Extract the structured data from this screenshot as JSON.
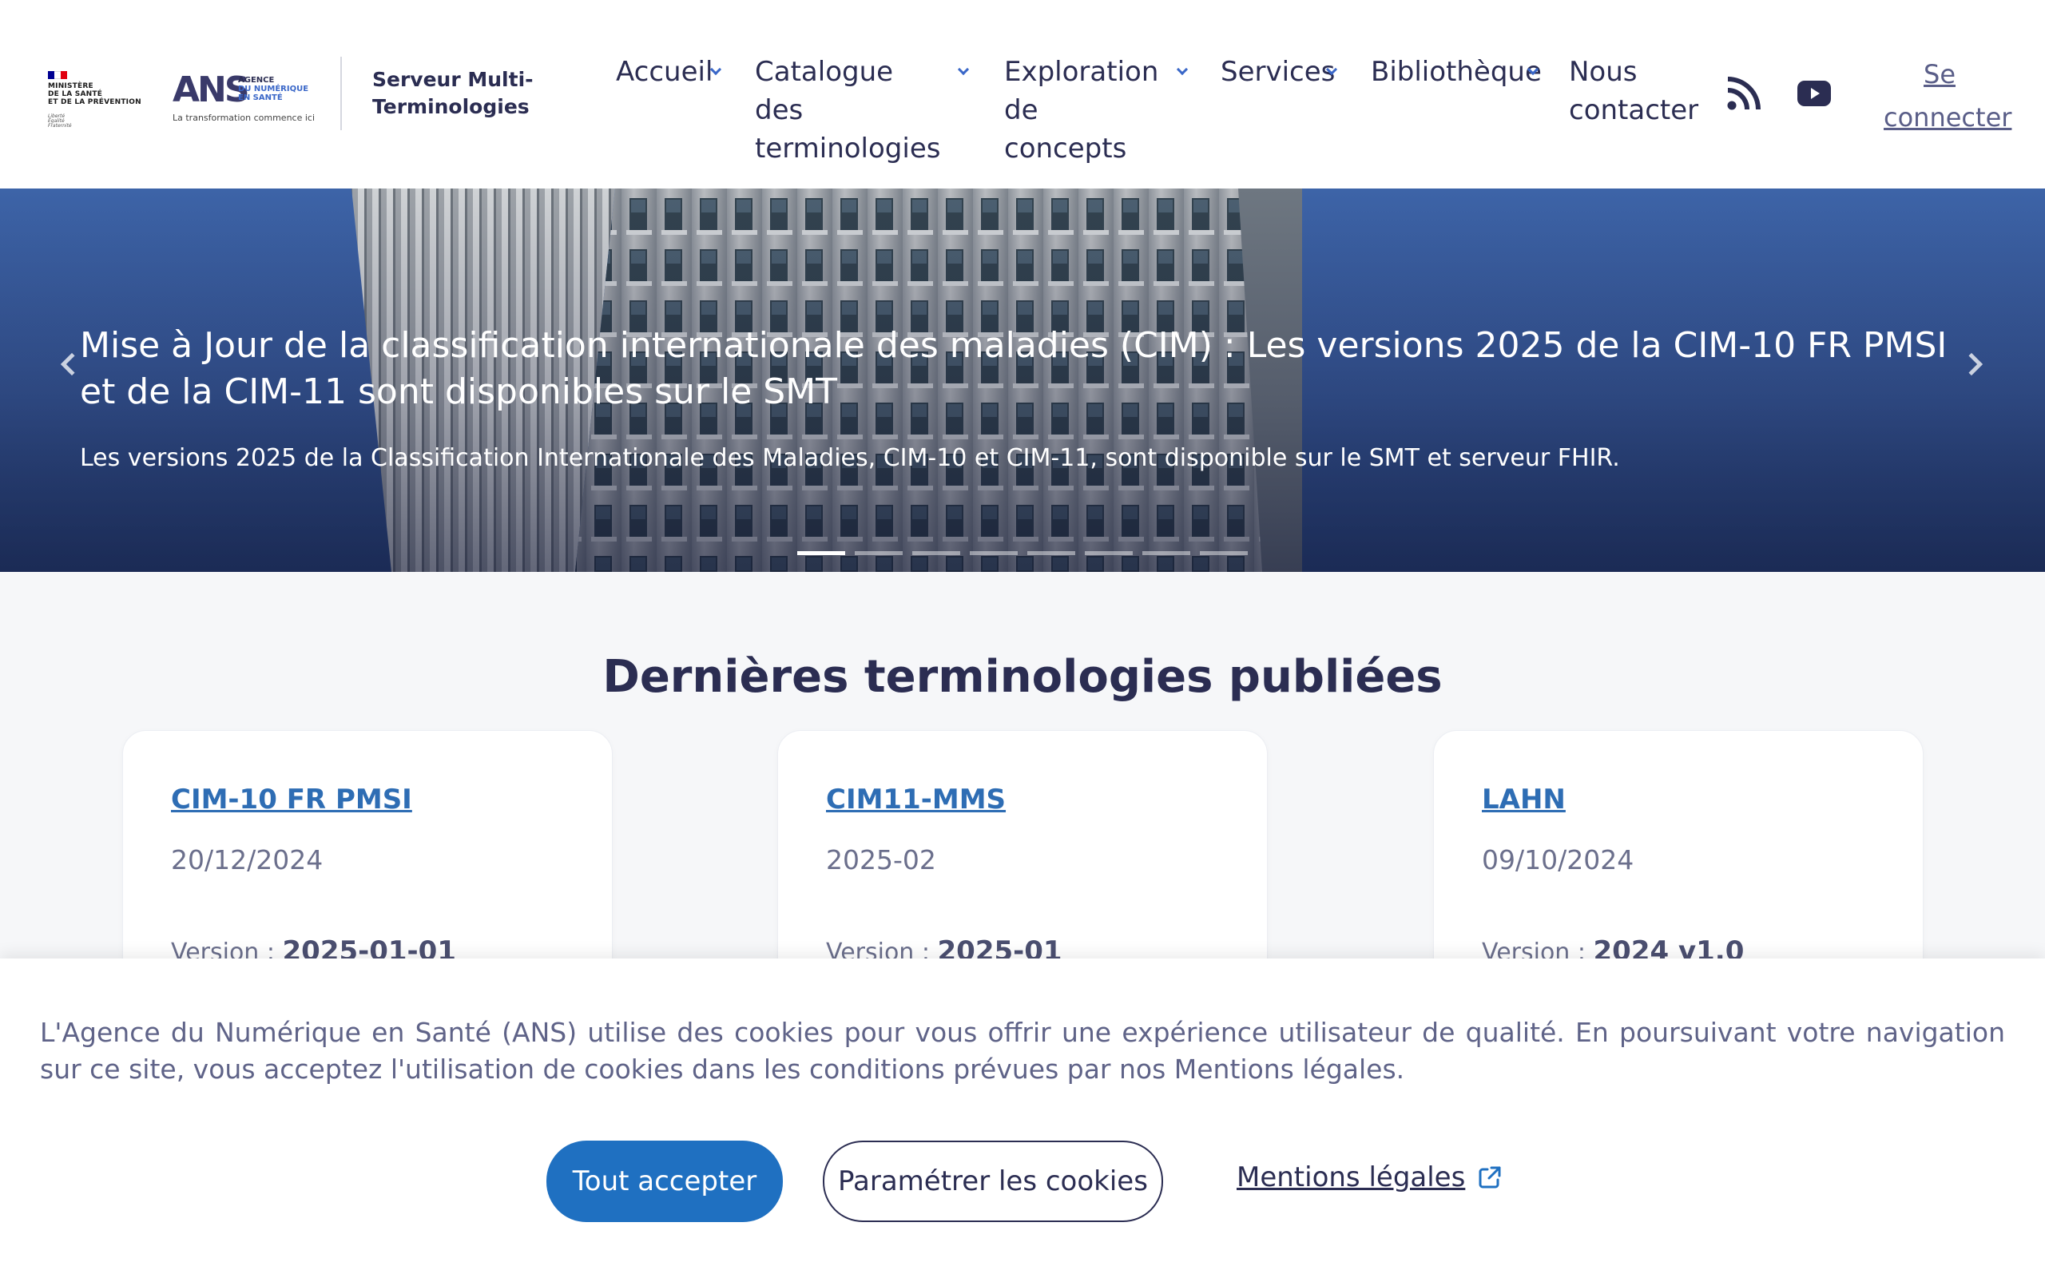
{
  "header": {
    "ministere_text": "MINISTÈRE\nDE LA SANTÉ\nET DE LA PRÉVENTION",
    "ministere_motto": "Liberté\nÉgalité\nFraternité",
    "ans_mark": "ANS",
    "ans_agence": "AGENCE",
    "ans_numerique": "DU NUMÉRIQUE",
    "ans_sante": "EN SANTÉ",
    "ans_tagline": "La transformation commence ici",
    "site_name": "Serveur Multi-\nTerminologies",
    "login_label": "Se\nconnecter"
  },
  "nav": {
    "accueil": "Accueil",
    "catalogue": "Catalogue des\nterminologies",
    "exploration": "Exploration\nde concepts",
    "services": "Services",
    "bibliotheque": "Bibliothèque",
    "contact": "Nous\ncontacter"
  },
  "social": {
    "rss_icon": "rss-icon",
    "youtube_icon": "youtube-icon"
  },
  "hero": {
    "title": "Mise à Jour de la classification internationale des maladies (CIM) : Les versions 2025 de la CIM-10 FR PMSI et de la CIM-11 sont disponibles sur le SMT",
    "description": "Les versions 2025 de la Classification Internationale des Maladies, CIM-10 et CIM-11, sont disponible sur le SMT et serveur FHIR.",
    "slides_count": 8,
    "active_slide": 1
  },
  "section": {
    "title": "Dernières terminologies publiées"
  },
  "cards": [
    {
      "title": "CIM-10 FR PMSI",
      "date": "20/12/2024",
      "version_label": "Version : ",
      "version": "2025-01-01"
    },
    {
      "title": "CIM11-MMS",
      "date": "2025-02",
      "version_label": "Version : ",
      "version": "2025-01"
    },
    {
      "title": "LAHN",
      "date": "09/10/2024",
      "version_label": "Version : ",
      "version": "2024 v1.0"
    }
  ],
  "cookie": {
    "text": "L'Agence du Numérique en Santé (ANS) utilise des cookies pour vous offrir une expérience utilisateur de qualité. En poursuivant votre navigation sur ce site, vous acceptez l'utilisation de cookies dans les conditions prévues par nos Mentions légales.",
    "accept_label": "Tout accepter",
    "settings_label": "Paramétrer les cookies",
    "legal_label": "Mentions légales"
  },
  "colors": {
    "primary_text": "#2b2d52",
    "accent_blue": "#1f70c1",
    "link_blue": "#2e6db4",
    "ans_pink": "#d6005c"
  }
}
